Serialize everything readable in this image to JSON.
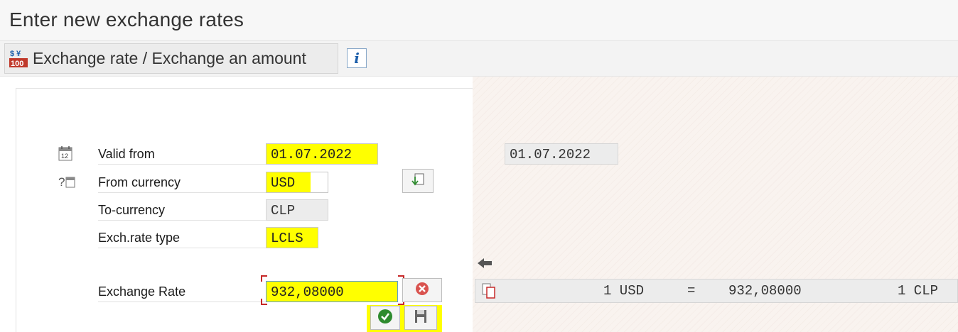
{
  "window": {
    "title": "Enter new exchange rates"
  },
  "toolbar": {
    "exchange_button_label": "Exchange rate / Exchange an amount",
    "exchange_button_icon": "exchange-rate-icon",
    "info_button_glyph": "i",
    "info_button_icon": "info-icon"
  },
  "form": {
    "valid_from": {
      "label": "Valid from",
      "value": "01.07.2022",
      "icon": "calendar-icon"
    },
    "from_currency": {
      "label": "From currency",
      "value": "USD",
      "icon": "help-icon"
    },
    "to_currency": {
      "label": "To-currency",
      "value": "CLP"
    },
    "rate_type": {
      "label": "Exch.rate type",
      "value": "LCLS"
    },
    "exchange_rate": {
      "label": "Exchange Rate",
      "value": "932,08000"
    }
  },
  "display": {
    "valid_from": "01.07.2022",
    "result_from_amount": "1 USD",
    "result_equals": "=",
    "result_rate": "932,08000",
    "result_to_amount": "1 CLP"
  },
  "colors": {
    "highlight": "#ffff00",
    "confirm_green": "#2e8b2e",
    "delete_red": "#d9534f",
    "accent_blue": "#1b5eaa"
  }
}
